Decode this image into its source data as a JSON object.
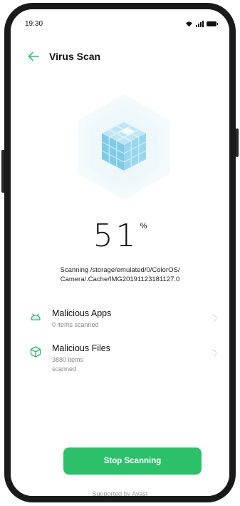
{
  "status_bar": {
    "time": "19:30"
  },
  "header": {
    "title": "Virus Scan"
  },
  "progress": {
    "value": "51",
    "unit": "%"
  },
  "scan_path": "Scanning /storage/emulated/0/ColorOS/ Camera/.Cache/IMG20191123181127.0",
  "items": [
    {
      "title": "Malicious Apps",
      "subtitle": "0 items scanned"
    },
    {
      "title": "Malicious Files",
      "subtitle": "3880 items scanned"
    }
  ],
  "stop_button": {
    "label": "Stop Scanning"
  },
  "footer": {
    "supported_by": "Supported by Avast"
  },
  "colors": {
    "accent": "#2dc06b",
    "icon_accent": "#2fb36b"
  }
}
